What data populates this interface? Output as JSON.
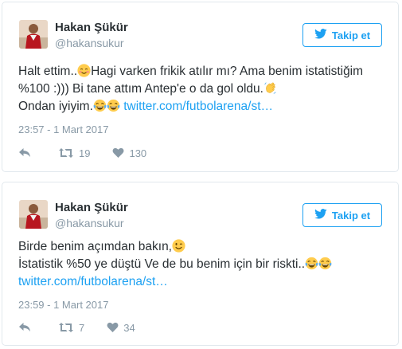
{
  "tweets": [
    {
      "name": "Hakan Şükür",
      "handle": "@hakansukur",
      "follow_label": "Takip et",
      "text_1": "Halt ettim..",
      "text_2": "Hagi varken frikik atılır mı? Ama benim istatistiğim %100 :))) Bi tane attım Antep'e o da gol oldu.",
      "text_3": "Ondan iyiyim.",
      "link": "twitter.com/futbolarena/st…",
      "timestamp": "23:57 - 1 Mart 2017",
      "retweets": "19",
      "likes": "130",
      "emojis": [
        "smiling-face-with-smiling-eyes",
        "waving-hand",
        "face-with-tears-of-joy",
        "face-with-tears-of-joy"
      ]
    },
    {
      "name": "Hakan Şükür",
      "handle": "@hakansukur",
      "follow_label": "Takip et",
      "text_1": "Birde benim açımdan bakın,",
      "text_2": "İstatistik %50 ye düştü Ve de bu benim için bir riskti..",
      "link": "twitter.com/futbolarena/st…",
      "timestamp": "23:59 - 1 Mart 2017",
      "retweets": "7",
      "likes": "34",
      "emojis": [
        "winking-face",
        "face-with-tears-of-joy",
        "face-with-tears-of-joy"
      ]
    }
  ],
  "colors": {
    "accent": "#1da1f2",
    "muted": "#8899a6",
    "text": "#292f33",
    "border": "#e1e8ed"
  },
  "icons": [
    "twitter-bird-icon",
    "reply-icon",
    "retweet-icon",
    "heart-icon"
  ]
}
